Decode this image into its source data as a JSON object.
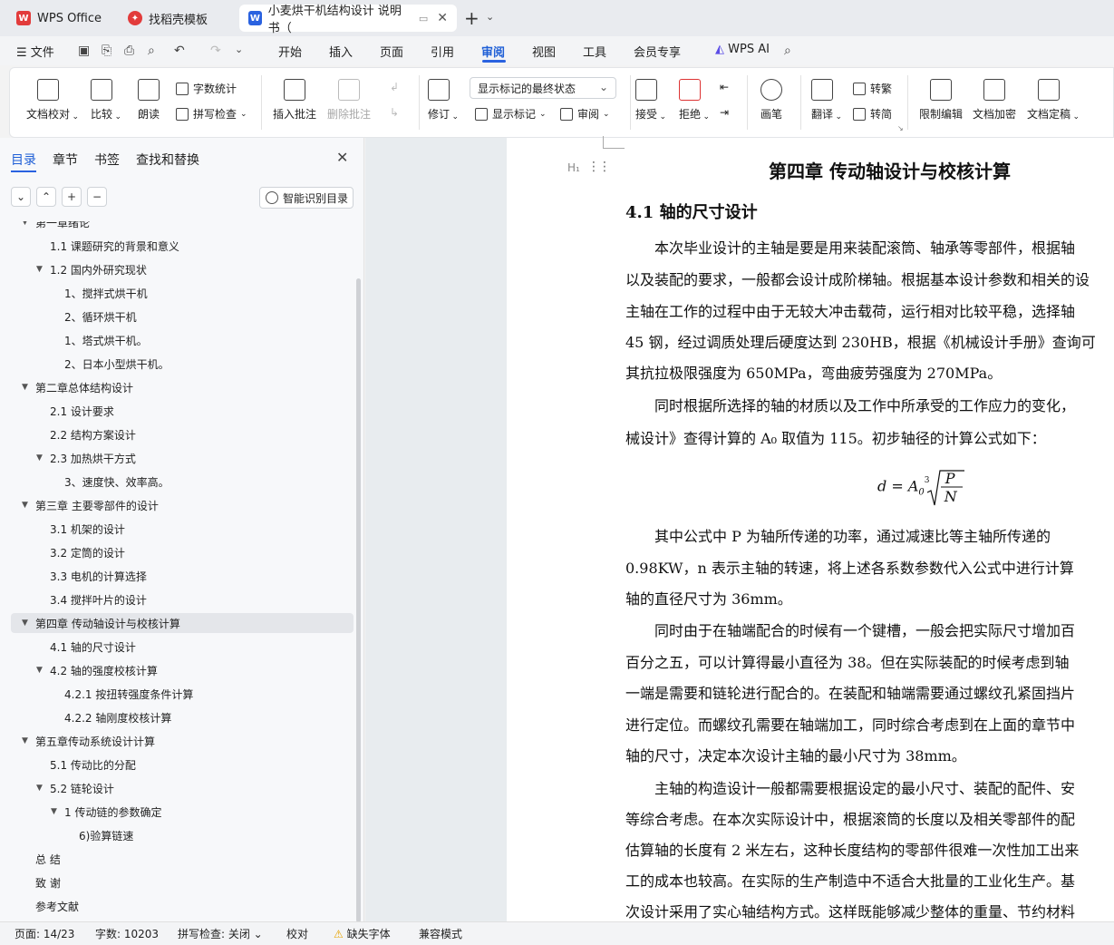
{
  "tabs": [
    {
      "label": "WPS Office",
      "icon": "wps-logo-icon"
    },
    {
      "label": "找稻壳模板",
      "icon": "docer-icon"
    },
    {
      "label": "小麦烘干机结构设计 说明书（",
      "icon": "word-doc-icon",
      "active": true
    }
  ],
  "menu": {
    "file": "文件",
    "items": [
      "开始",
      "插入",
      "页面",
      "引用",
      "审阅",
      "视图",
      "工具",
      "会员专享"
    ],
    "active": "审阅",
    "wps_ai": "WPS AI"
  },
  "ribbon": {
    "doc_check": "文档校对",
    "compare": "比较",
    "read_aloud": "朗读",
    "word_count": "字数统计",
    "spell_check": "拼写检查",
    "insert_comment": "插入批注",
    "delete_comment": "删除批注",
    "revise": "修订",
    "show_state": "显示标记的最终状态",
    "show_markup": "显示标记",
    "review": "审阅",
    "accept": "接受",
    "reject": "拒绝",
    "pen": "画笔",
    "translate": "翻译",
    "to_traditional": "转繁",
    "to_simplified": "转简",
    "restrict_edit": "限制编辑",
    "encrypt": "文档加密",
    "finalize": "文档定稿"
  },
  "sidebar": {
    "tabs": [
      "目录",
      "章节",
      "书签",
      "查找和替换"
    ],
    "smart_toc": "智能识别目录",
    "toc": [
      {
        "label": "第一章绪论",
        "level": 1,
        "expanded": true
      },
      {
        "label": "1.1  课题研究的背景和意义",
        "level": 2
      },
      {
        "label": "1.2  国内外研究现状",
        "level": 2,
        "expanded": true
      },
      {
        "label": "1、搅拌式烘干机",
        "level": 3
      },
      {
        "label": "2、循环烘干机",
        "level": 3
      },
      {
        "label": "1、塔式烘干机。",
        "level": 3
      },
      {
        "label": "2、日本小型烘干机。",
        "level": 3
      },
      {
        "label": "第二章总体结构设计",
        "level": 1,
        "expanded": true
      },
      {
        "label": "2.1  设计要求",
        "level": 2
      },
      {
        "label": "2.2  结构方案设计",
        "level": 2
      },
      {
        "label": "2.3  加热烘干方式",
        "level": 2,
        "expanded": true
      },
      {
        "label": "3、速度快、效率高。",
        "level": 3
      },
      {
        "label": "第三章  主要零部件的设计",
        "level": 1,
        "expanded": true
      },
      {
        "label": "3.1  机架的设计",
        "level": 2
      },
      {
        "label": "3.2  定筒的设计",
        "level": 2
      },
      {
        "label": "3.3 电机的计算选择",
        "level": 2
      },
      {
        "label": "3.4  搅拌叶片的设计",
        "level": 2
      },
      {
        "label": "第四章  传动轴设计与校核计算",
        "level": 1,
        "expanded": true,
        "selected": true
      },
      {
        "label": "4.1  轴的尺寸设计",
        "level": 2
      },
      {
        "label": "4.2  轴的强度校核计算",
        "level": 2,
        "expanded": true
      },
      {
        "label": "4.2.1  按扭转强度条件计算",
        "level": 3
      },
      {
        "label": "4.2.2 轴刚度校核计算",
        "level": 3
      },
      {
        "label": "第五章传动系统设计计算",
        "level": 1,
        "expanded": true
      },
      {
        "label": "5.1  传动比的分配",
        "level": 2
      },
      {
        "label": "5.2  链轮设计",
        "level": 2,
        "expanded": true
      },
      {
        "label": "1 传动链的参数确定",
        "level": 3,
        "expanded": true
      },
      {
        "label": "6)验算链速",
        "level": 4
      },
      {
        "label": "总 结",
        "level": 1
      },
      {
        "label": "致 谢",
        "level": 1
      },
      {
        "label": "参考文献",
        "level": 1
      }
    ]
  },
  "document": {
    "chapter_title": "第四章  传动轴设计与校核计算",
    "section_title": "4.1  轴的尺寸设计",
    "lines": [
      "　　本次毕业设计的主轴是要是用来装配滚筒、轴承等零部件，根据轴",
      "以及装配的要求，一般都会设计成阶梯轴。根据基本设计参数和相关的设",
      "主轴在工作的过程中由于无较大冲击载荷，运行相对比较平稳，选择轴",
      "45 钢，经过调质处理后硬度达到 230HB，根据《机械设计手册》查询可",
      "其抗拉极限强度为 650MPa，弯曲疲劳强度为 270MPa。",
      "　　同时根据所选择的轴的材质以及工作中所承受的工作应力的变化，",
      "械设计》查得计算的 A₀ 取值为 115。初步轴径的计算公式如下：",
      "　　其中公式中 P 为轴所传递的功率，通过减速比等主轴所传递的",
      "0.98KW，n 表示主轴的转速，将上述各系数参数代入公式中进行计算",
      "轴的直径尺寸为 36mm。",
      "　　同时由于在轴端配合的时候有一个键槽，一般会把实际尺寸增加百",
      "百分之五，可以计算得最小直径为 38。但在实际装配的时候考虑到轴",
      "一端是需要和链轮进行配合的。在装配和轴端需要通过螺纹孔紧固挡片",
      "进行定位。而螺纹孔需要在轴端加工，同时综合考虑到在上面的章节中",
      "轴的尺寸，决定本次设计主轴的最小尺寸为 38mm。",
      "　　主轴的构造设计一般都需要根据设定的最小尺寸、装配的配件、安",
      "等综合考虑。在本次实际设计中，根据滚筒的长度以及相关零部件的配",
      "估算轴的长度有 2 米左右，这种长度结构的零部件很难一次性加工出来",
      "工的成本也较高。在实际的生产制造中不适合大批量的工业化生产。基",
      "次设计采用了实心轴结构方式。这样既能够减少整体的重量、节约材料"
    ],
    "formula": {
      "lhs": "d = A",
      "sub": "0",
      "root_index": "3",
      "num": "P",
      "den": "N"
    }
  },
  "status": {
    "page": "页面: 14/23",
    "words": "字数: 10203",
    "spell": "拼写检查: 关闭",
    "proof": "校对",
    "missing_font": "缺失字体",
    "compat": "兼容模式"
  },
  "colors": {
    "accent": "#2a62e0",
    "wps_red": "#e23b3b",
    "doc_blue": "#2a62e0"
  }
}
